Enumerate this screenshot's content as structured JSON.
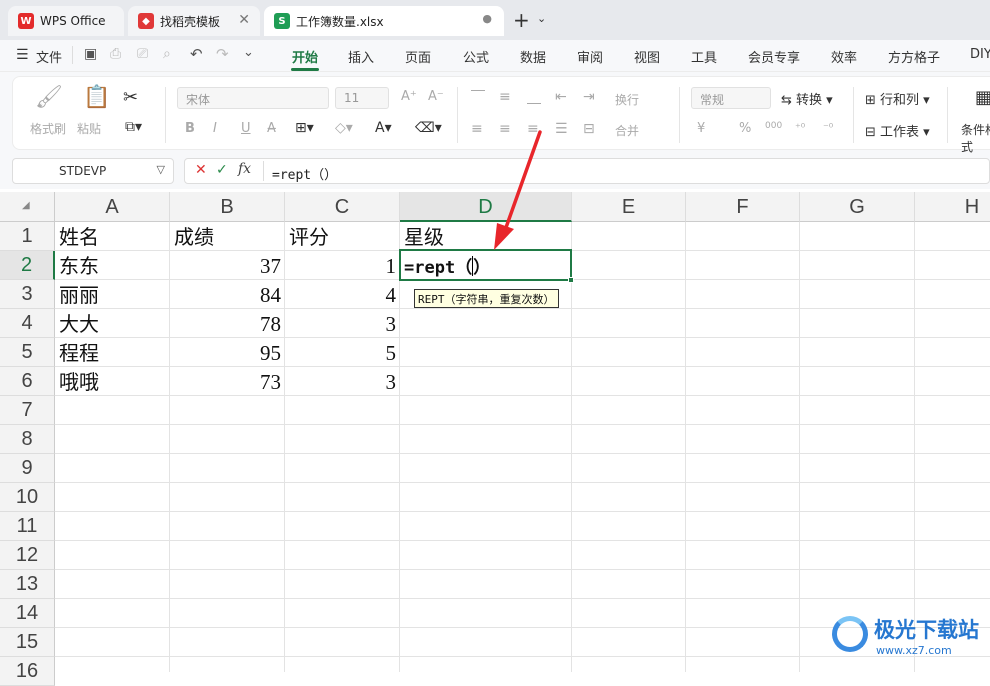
{
  "tabs": [
    {
      "label": "WPS Office"
    },
    {
      "label": "找稻壳模板"
    },
    {
      "label": "工作簿数量.xlsx"
    }
  ],
  "menu": [
    "文件",
    "开始",
    "插入",
    "页面",
    "公式",
    "数据",
    "审阅",
    "视图",
    "工具",
    "会员专享",
    "效率",
    "方方格子",
    "DIY"
  ],
  "ribbon": {
    "format_painter": "格式刷",
    "paste": "粘贴",
    "font_name": "宋体",
    "font_size": "11",
    "bold": "B",
    "italic": "I",
    "underline": "U",
    "wrap": "换行",
    "merge": "合并",
    "number_format": "常规",
    "convert": "转换",
    "row_col": "行和列",
    "worksheet": "工作表",
    "conditional": "条件格式",
    "currency": "¥",
    "percent": "%",
    "thousands": "000"
  },
  "formula_bar": {
    "name_box": "STDEVP",
    "fx": "fx",
    "formula": "=rept（）"
  },
  "columns": [
    "A",
    "B",
    "C",
    "D",
    "E",
    "F",
    "G",
    "H"
  ],
  "rows": [
    "1",
    "2",
    "3",
    "4",
    "5",
    "6",
    "7",
    "8",
    "9",
    "10",
    "11",
    "12",
    "13",
    "14",
    "15",
    "16"
  ],
  "cells": {
    "headers": [
      "姓名",
      "成绩",
      "评分",
      "星级"
    ],
    "names": [
      "东东",
      "丽丽",
      "大大",
      "程程",
      "哦哦"
    ],
    "scores": [
      "37",
      "84",
      "78",
      "95",
      "73"
    ],
    "ratings": [
      "1",
      "4",
      "3",
      "5",
      "3"
    ],
    "active_cell_text": "=rept（",
    "active_cell_close": "）"
  },
  "tooltip": "REPT（字符串，重复次数）",
  "watermark": {
    "title": "极光下载站",
    "url": "www.xz7.com"
  },
  "colors": {
    "accent_green": "#1f7a45",
    "arrow_red": "#e8262b",
    "tab_bar": "#e7e9ed"
  }
}
